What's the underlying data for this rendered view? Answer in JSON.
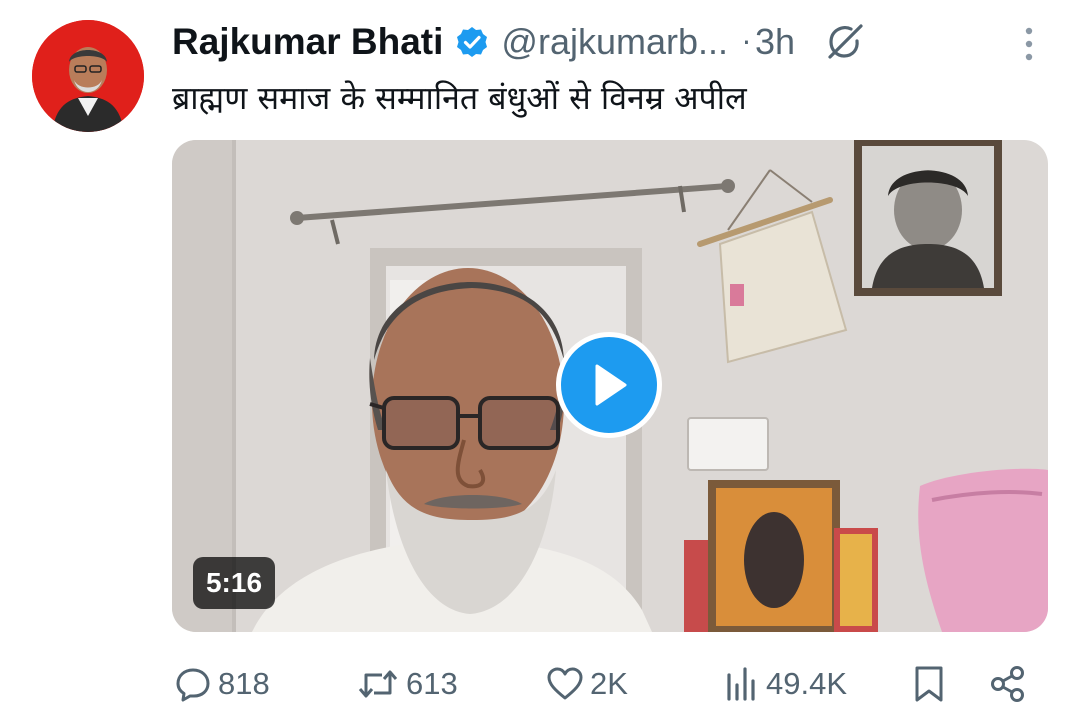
{
  "tweet": {
    "author_name": "Rajkumar Bhati",
    "handle": "@rajkumarb...",
    "separator": "·",
    "time": "3h",
    "text": "ब्राह्मण समाज के सम्मानित बंधुओं से विनम्र अपील",
    "icons": {
      "verified": "verified-badge-icon",
      "grok": "grok-icon",
      "more": "more-options-icon",
      "play": "play-icon"
    },
    "video": {
      "duration": "5:16"
    }
  },
  "actions": {
    "replies": "818",
    "reposts": "613",
    "likes": "2K",
    "views": "49.4K"
  },
  "colors": {
    "accent": "#1d9bf0",
    "avatar_bg": "#e0201b",
    "muted": "#536471"
  }
}
